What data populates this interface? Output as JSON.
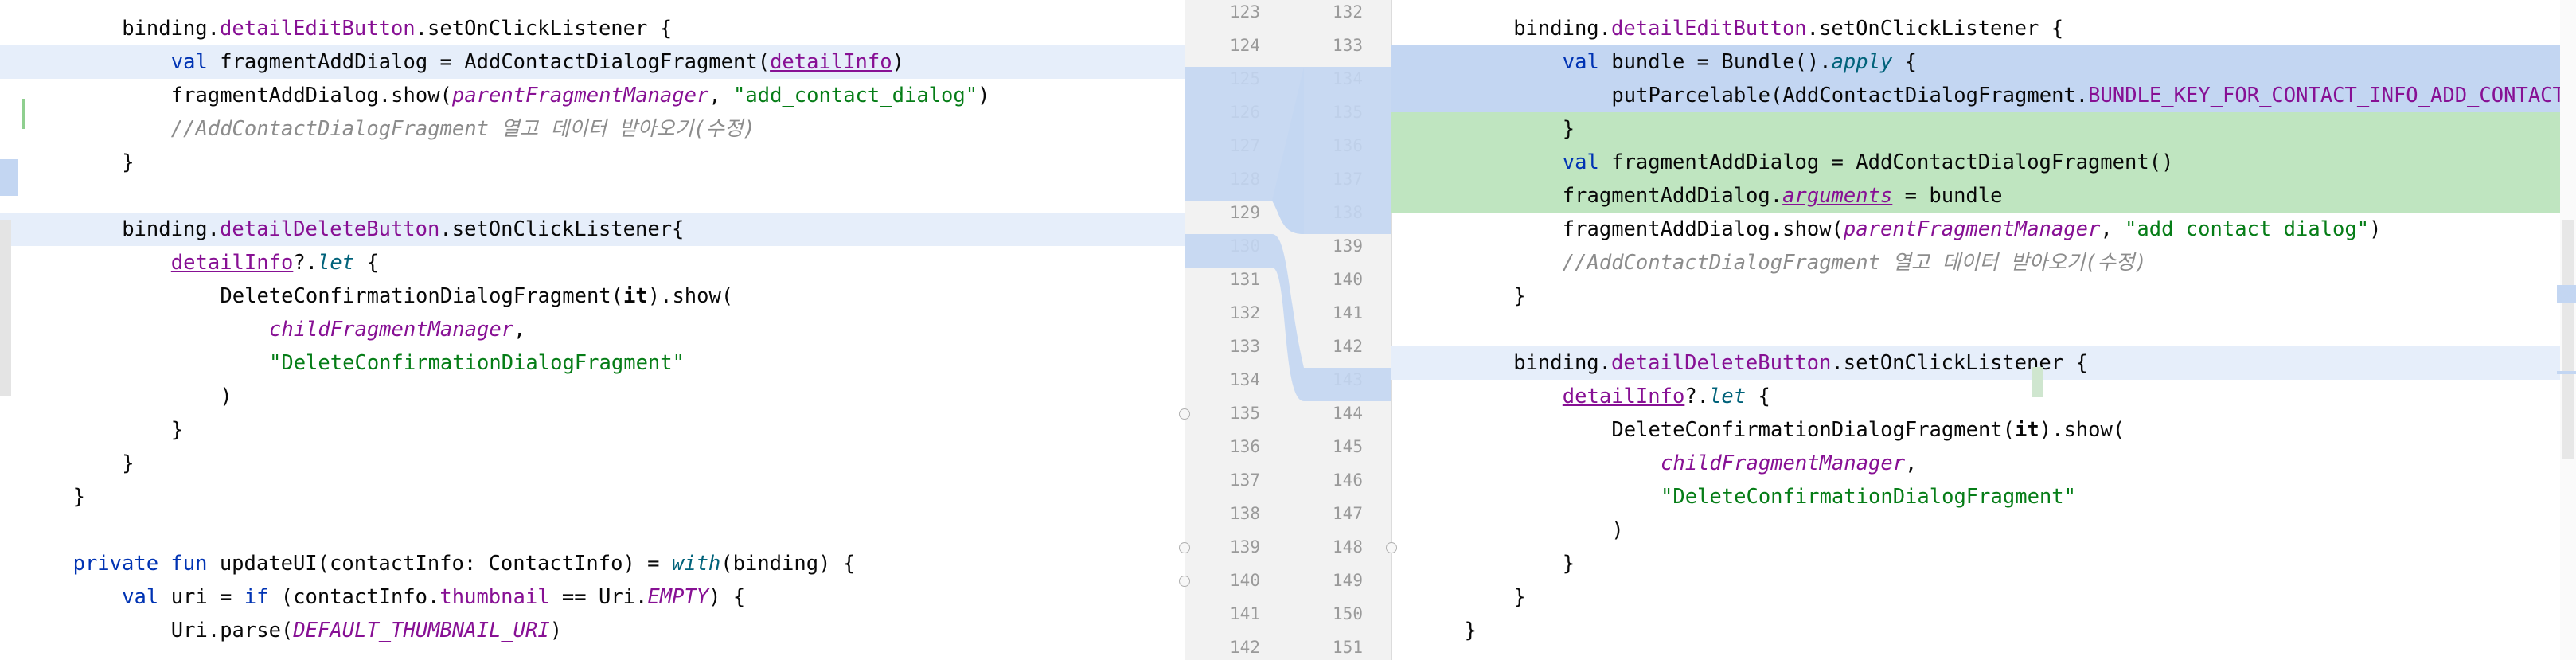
{
  "left_pane": {
    "lines": [
      {
        "bg": "",
        "indent": 4,
        "tokens": [
          {
            "t": "binding."
          },
          {
            "t": "detailEditButton",
            "c": "prop"
          },
          {
            "t": ".setOnClickListener {"
          }
        ]
      },
      {
        "bg": "mod",
        "indent": 6,
        "tokens": [
          {
            "t": "val ",
            "c": "kw"
          },
          {
            "t": "fragmentAddDialog = AddContactDialogFragment("
          },
          {
            "t": "detailInfo",
            "c": "prop ul"
          },
          {
            "t": ")"
          }
        ]
      },
      {
        "bg": "",
        "indent": 6,
        "tokens": [
          {
            "t": "fragmentAddDialog.show("
          },
          {
            "t": "parentFragmentManager",
            "c": "param"
          },
          {
            "t": ", "
          },
          {
            "t": "\"add_contact_dialog\"",
            "c": "str"
          },
          {
            "t": ")"
          }
        ]
      },
      {
        "bg": "",
        "indent": 6,
        "tokens": [
          {
            "t": "//AddContactDialogFragment 열고 데이터 받아오기(수정)",
            "c": "cmt"
          }
        ]
      },
      {
        "bg": "",
        "indent": 4,
        "tokens": [
          {
            "t": "}"
          }
        ]
      },
      {
        "bg": "",
        "indent": 0,
        "tokens": []
      },
      {
        "bg": "mod",
        "indent": 4,
        "tokens": [
          {
            "t": "binding."
          },
          {
            "t": "detailDeleteButton",
            "c": "prop"
          },
          {
            "t": ".setOnClickListener{"
          }
        ]
      },
      {
        "bg": "",
        "indent": 6,
        "tokens": [
          {
            "t": "detailInfo",
            "c": "prop ul"
          },
          {
            "t": "?."
          },
          {
            "t": "let",
            "c": "ital-fn"
          },
          {
            "t": " {"
          }
        ]
      },
      {
        "bg": "",
        "indent": 8,
        "tokens": [
          {
            "t": "DeleteConfirmationDialogFragment("
          },
          {
            "t": "it",
            "c": "bold"
          },
          {
            "t": ").show("
          }
        ]
      },
      {
        "bg": "",
        "indent": 10,
        "tokens": [
          {
            "t": "childFragmentManager",
            "c": "param"
          },
          {
            "t": ","
          }
        ]
      },
      {
        "bg": "",
        "indent": 10,
        "tokens": [
          {
            "t": "\"DeleteConfirmationDialogFragment\"",
            "c": "str"
          }
        ]
      },
      {
        "bg": "",
        "indent": 8,
        "tokens": [
          {
            "t": ")"
          }
        ]
      },
      {
        "bg": "",
        "indent": 6,
        "tokens": [
          {
            "t": "}"
          }
        ]
      },
      {
        "bg": "",
        "indent": 4,
        "tokens": [
          {
            "t": "}"
          }
        ]
      },
      {
        "bg": "",
        "indent": 2,
        "tokens": [
          {
            "t": "}"
          }
        ]
      },
      {
        "bg": "",
        "indent": 0,
        "tokens": []
      },
      {
        "bg": "",
        "indent": 2,
        "tokens": [
          {
            "t": "private fun ",
            "c": "kw"
          },
          {
            "t": "updateUI(contactInfo: ContactInfo) = "
          },
          {
            "t": "with",
            "c": "ital-fn"
          },
          {
            "t": "(binding) {"
          }
        ]
      },
      {
        "bg": "",
        "indent": 4,
        "tokens": [
          {
            "t": "val ",
            "c": "kw"
          },
          {
            "t": "uri = "
          },
          {
            "t": "if ",
            "c": "kw"
          },
          {
            "t": "(contactInfo."
          },
          {
            "t": "thumbnail",
            "c": "prop"
          },
          {
            "t": " == Uri."
          },
          {
            "t": "EMPTY",
            "c": "const"
          },
          {
            "t": ") {"
          }
        ]
      },
      {
        "bg": "",
        "indent": 6,
        "tokens": [
          {
            "t": "Uri.parse("
          },
          {
            "t": "DEFAULT_THUMBNAIL_URI",
            "c": "const"
          },
          {
            "t": ")"
          }
        ]
      }
    ]
  },
  "right_pane": {
    "lines": [
      {
        "bg": "",
        "indent": 4,
        "tokens": [
          {
            "t": "binding."
          },
          {
            "t": "detailEditButton",
            "c": "prop"
          },
          {
            "t": ".setOnClickListener {"
          }
        ]
      },
      {
        "bg": "mod-strong",
        "indent": 6,
        "tokens": [
          {
            "t": "val ",
            "c": "kw"
          },
          {
            "t": "bundle = Bundle()."
          },
          {
            "t": "apply",
            "c": "ital-fn"
          },
          {
            "t": " {"
          }
        ]
      },
      {
        "bg": "mod-strong",
        "indent": 8,
        "tokens": [
          {
            "t": "putParcelable(AddContactDialogFragment."
          },
          {
            "t": "BUNDLE_KEY_FOR_CONTACT_INFO_ADD_CONTACT_DIALOG",
            "c": "prop"
          }
        ]
      },
      {
        "bg": "add",
        "indent": 6,
        "tokens": [
          {
            "t": "}"
          }
        ]
      },
      {
        "bg": "add",
        "indent": 6,
        "tokens": [
          {
            "t": "val ",
            "c": "kw"
          },
          {
            "t": "fragmentAddDialog = AddContactDialogFragment()"
          }
        ]
      },
      {
        "bg": "add",
        "indent": 6,
        "tokens": [
          {
            "t": "fragmentAddDialog."
          },
          {
            "t": "arguments",
            "c": "param ul"
          },
          {
            "t": " = bundle"
          }
        ]
      },
      {
        "bg": "",
        "indent": 6,
        "tokens": [
          {
            "t": "fragmentAddDialog.show("
          },
          {
            "t": "parentFragmentManager",
            "c": "param"
          },
          {
            "t": ", "
          },
          {
            "t": "\"add_contact_dialog\"",
            "c": "str"
          },
          {
            "t": ")"
          }
        ]
      },
      {
        "bg": "",
        "indent": 6,
        "tokens": [
          {
            "t": "//AddContactDialogFragment 열고 데이터 받아오기(수정)",
            "c": "cmt"
          }
        ]
      },
      {
        "bg": "",
        "indent": 4,
        "tokens": [
          {
            "t": "}"
          }
        ]
      },
      {
        "bg": "",
        "indent": 0,
        "tokens": []
      },
      {
        "bg": "mod",
        "indent": 4,
        "tokens": [
          {
            "t": "binding."
          },
          {
            "t": "detailDeleteButton",
            "c": "prop"
          },
          {
            "t": ".setOnClickListener {"
          }
        ]
      },
      {
        "bg": "",
        "indent": 6,
        "tokens": [
          {
            "t": "detailInfo",
            "c": "prop ul"
          },
          {
            "t": "?."
          },
          {
            "t": "let",
            "c": "ital-fn"
          },
          {
            "t": " {"
          }
        ]
      },
      {
        "bg": "",
        "indent": 8,
        "tokens": [
          {
            "t": "DeleteConfirmationDialogFragment("
          },
          {
            "t": "it",
            "c": "bold"
          },
          {
            "t": ").show("
          }
        ]
      },
      {
        "bg": "",
        "indent": 10,
        "tokens": [
          {
            "t": "childFragmentManager",
            "c": "param"
          },
          {
            "t": ","
          }
        ]
      },
      {
        "bg": "",
        "indent": 10,
        "tokens": [
          {
            "t": "\"DeleteConfirmationDialogFragment\"",
            "c": "str"
          }
        ]
      },
      {
        "bg": "",
        "indent": 8,
        "tokens": [
          {
            "t": ")"
          }
        ]
      },
      {
        "bg": "",
        "indent": 6,
        "tokens": [
          {
            "t": "}"
          }
        ]
      },
      {
        "bg": "",
        "indent": 4,
        "tokens": [
          {
            "t": "}"
          }
        ]
      },
      {
        "bg": "",
        "indent": 2,
        "tokens": [
          {
            "t": "}"
          }
        ]
      }
    ]
  },
  "gutter": {
    "left_numbers": [
      "123",
      "124",
      "125",
      "126",
      "127",
      "128",
      "129",
      "130",
      "131",
      "132",
      "133",
      "134",
      "135",
      "136",
      "137",
      "138",
      "139",
      "140",
      "141",
      "142"
    ],
    "right_numbers": [
      "132",
      "133",
      "134",
      "135",
      "136",
      "137",
      "138",
      "139",
      "140",
      "141",
      "142",
      "143",
      "144",
      "145",
      "146",
      "147",
      "148",
      "149",
      "150",
      "151"
    ]
  },
  "colors": {
    "modified": "#e6eefa",
    "modified_strong": "#c3d6f2",
    "added": "#bfe5c0",
    "ribbon": "#c3d6f2",
    "keyword": "#0033b3",
    "string": "#067d17",
    "property": "#871094",
    "comment": "#8c8c8c"
  }
}
